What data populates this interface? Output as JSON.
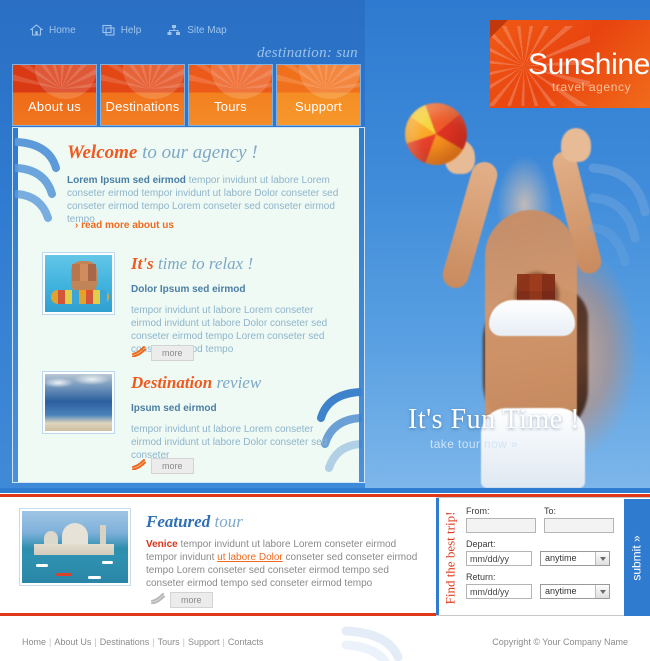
{
  "site": {
    "tagline": "destination: sun"
  },
  "logo": {
    "title": "Sunshine",
    "subtitle": "travel agency"
  },
  "util_nav": {
    "items": [
      {
        "label": "Home",
        "icon": "home-icon"
      },
      {
        "label": "Help",
        "icon": "help-icon"
      },
      {
        "label": "Site Map",
        "icon": "sitemap-icon"
      }
    ]
  },
  "tabs": [
    {
      "label": "About us"
    },
    {
      "label": "Destinations"
    },
    {
      "label": "Tours"
    },
    {
      "label": "Support"
    }
  ],
  "welcome": {
    "title_bold": "Welcome",
    "title_rest": " to our agency !",
    "lead": "Lorem Ipsum sed eirmod",
    "body": " tempor invidunt ut labore Lorem conseter eirmod tempor invidunt ut labore Dolor conseter sed conseter eirmod tempo Lorem conseter sed conseter eirmod tempo",
    "read_more": "› read more about us"
  },
  "sections": [
    {
      "title_bold": "It's",
      "title_rest": " time to relax !",
      "lead": "Dolor Ipsum sed eirmod",
      "body": "tempor invidunt ut labore Lorem conseter eirmod invidunt ut labore Dolor conseter sed conseter eirmod tempo Lorem conseter sed conseter eirmod tempo",
      "more_label": "more",
      "thumb": "pool-photo"
    },
    {
      "title_bold": "Destination",
      "title_rest": " review",
      "lead": "Ipsum sed eirmod",
      "body": "tempor invidunt ut labore Lorem conseter eirmod invidunt ut labore Dolor conseter sed conseter",
      "more_label": "more",
      "thumb": "beach-photo"
    }
  ],
  "hero": {
    "headline": "It's Fun Time !",
    "subline": "take tour now »"
  },
  "featured": {
    "title_bold": "Featured",
    "title_rest": " tour",
    "highlight": "Venice",
    "body_1": " tempor invidunt ut labore Lorem conseter eirmod tempor invidunt ",
    "link": "ut labore Dolor",
    "body_2": " conseter sed conseter eirmod tempo Lorem conseter sed conseter eirmod tempo sed conseter eirmod tempo sed conseter eirmod tempo",
    "more_label": "more",
    "thumb": "venice-photo"
  },
  "booking": {
    "vertical_label": "Find the best trip!",
    "from_label": "From:",
    "from_value": "",
    "to_label": "To:",
    "to_value": "",
    "depart_label": "Depart:",
    "depart_value": "mm/dd/yy",
    "depart_time": "anytime",
    "return_label": "Return:",
    "return_value": "mm/dd/yy",
    "return_time": "anytime",
    "submit_label": "submit »"
  },
  "footer": {
    "links": [
      "Home",
      "About Us",
      "Destinations",
      "Tours",
      "Support",
      "Contacts"
    ],
    "copyright": "Copyright © Your Company Name"
  },
  "colors": {
    "brand_orange": "#ee5a1f",
    "brand_blue": "#2f7bd0",
    "accent_red": "#e0391a",
    "panel_mint": "#eefaf3",
    "muted_text": "#8fb4cd"
  }
}
